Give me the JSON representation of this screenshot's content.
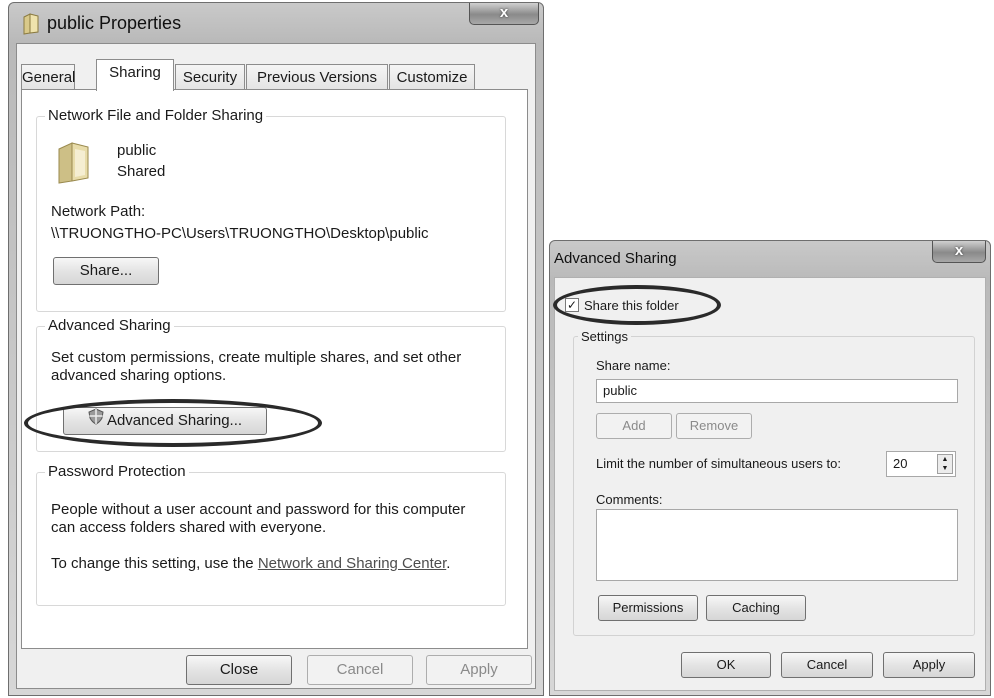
{
  "properties_dialog": {
    "title": "public Properties",
    "close_glyph": "x",
    "tabs": [
      {
        "label": "General"
      },
      {
        "label": "Sharing"
      },
      {
        "label": "Security"
      },
      {
        "label": "Previous Versions"
      },
      {
        "label": "Customize"
      }
    ],
    "network_sharing": {
      "title": "Network File and Folder Sharing",
      "folder_name": "public",
      "folder_state": "Shared",
      "network_path_label": "Network Path:",
      "network_path": "\\\\TRUONGTHO-PC\\Users\\TRUONGTHO\\Desktop\\public",
      "share_button": "Share..."
    },
    "advanced_sharing": {
      "title": "Advanced Sharing",
      "description_line1": "Set custom permissions, create multiple shares, and set other",
      "description_line2": "advanced sharing options.",
      "button": "Advanced Sharing..."
    },
    "password_protection": {
      "title": "Password Protection",
      "line1": "People without a user account and password for this computer",
      "line2": "can access folders shared with everyone.",
      "change_prefix": "To change this setting, use the ",
      "change_link": "Network and Sharing Center",
      "change_suffix": "."
    },
    "buttons": {
      "close": "Close",
      "cancel": "Cancel",
      "apply": "Apply"
    }
  },
  "advanced_dialog": {
    "title": "Advanced Sharing",
    "close_glyph": "x",
    "share_checkbox_label": "Share this folder",
    "share_checked": true,
    "settings_title": "Settings",
    "share_name_label": "Share name:",
    "share_name_value": "public",
    "add_button": "Add",
    "remove_button": "Remove",
    "limit_label": "Limit the number of simultaneous users to:",
    "limit_value": "20",
    "comments_label": "Comments:",
    "comments_value": "",
    "permissions_button": "Permissions",
    "caching_button": "Caching",
    "buttons": {
      "ok": "OK",
      "cancel": "Cancel",
      "apply": "Apply"
    }
  }
}
